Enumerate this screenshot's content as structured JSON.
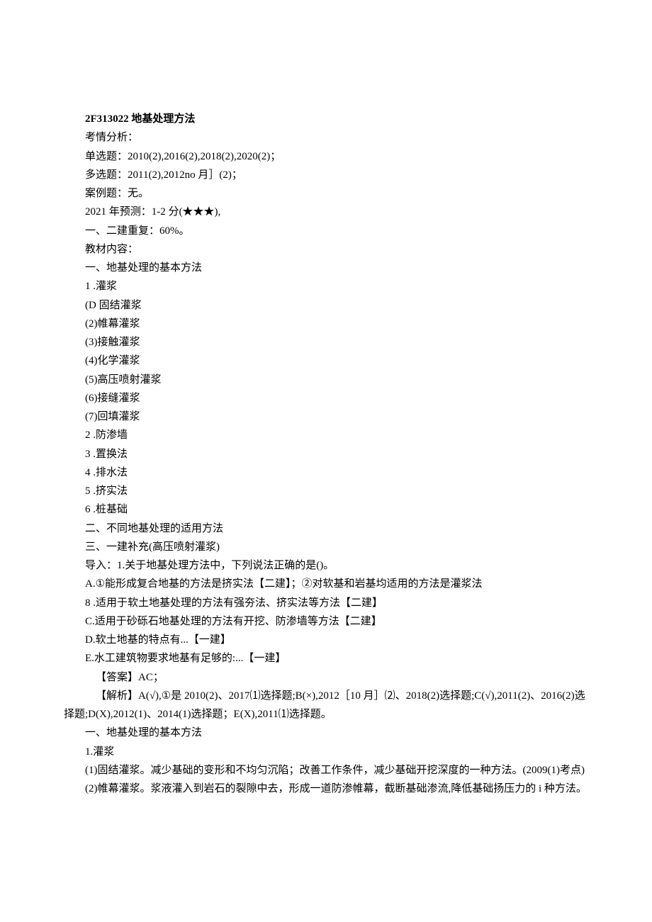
{
  "title": "2F313022 地基处理方法",
  "kao_qing_header": "考情分析：",
  "items": {
    "single": "单选题：2010(2),2016(2),2018(2),2020(2)；",
    "multi": "多选题：2011(2),2012no 月］(2)；",
    "case": "案例题：无。",
    "predict": "2021 年预测：1-2 分(★★★),",
    "overlap": "一、二建重复：60%。"
  },
  "textbook_header": "教材内容：",
  "sec1_header": "一、地基处理的基本方法",
  "sec1": {
    "g_header": "1 .灌浆",
    "g1": "(D 固结灌浆",
    "g2": "(2)帷幕灌浆",
    "g3": "(3)接触灌浆",
    "g4": "(4)化学灌浆",
    "g5": "(5)高压喷射灌浆",
    "g6": "(6)接缝灌浆",
    "g7": "(7)回填灌浆",
    "m2": "2 .防渗墙",
    "m3": "3 .置换法",
    "m4": "4 .排水法",
    "m5": "5 .挤实法",
    "m6": "6 .桩基础"
  },
  "sec2_header": "二、不同地基处理的适用方法",
  "sec3_header": "三、一建补充(高压喷射灌浆)",
  "daoru": "导入：1.关于地基处理方法中，下列说法正确的是()。",
  "options": {
    "A": "A.①能形成复合地基的方法是挤实法【二建】；②对软基和岩基均适用的方法是灌浆法",
    "B": "8 .适用于软土地基处理的方法有强夯法、挤实法等方法【二建】",
    "C": "C.适用于砂砾石地基处理的方法有开挖、防渗墙等方法【二建】",
    "D": "D.软土地基的特点有...【一建】",
    "E": "E.水工建筑物要求地基有足够的:...【一建】"
  },
  "answer": "【答案】AC；",
  "analysis": "【解析】A(√),①是 2010(2)、2017⑴选择题;B(×),2012［10 月］⑵、2018(2)选择题;C(√),2011(2)、2016(2)选择题;D(X),2012(1)、2014(1)选择题；E(X),2011⑴选择题。",
  "repeat_sec1_header": "一、地基处理的基本方法",
  "repeat_g_header": "1.灌浆",
  "detail1": "(1)固结灌浆。减少基础的变形和不均匀沉陷；改善工作条件，减少基础开挖深度的一种方法。(2009(1)考点)",
  "detail2": "(2)帷幕灌浆。浆液灌入到岩石的裂隙中去，形成一道防渗帷幕，截断基础渗流,降低基础扬压力的 i 种方法。"
}
